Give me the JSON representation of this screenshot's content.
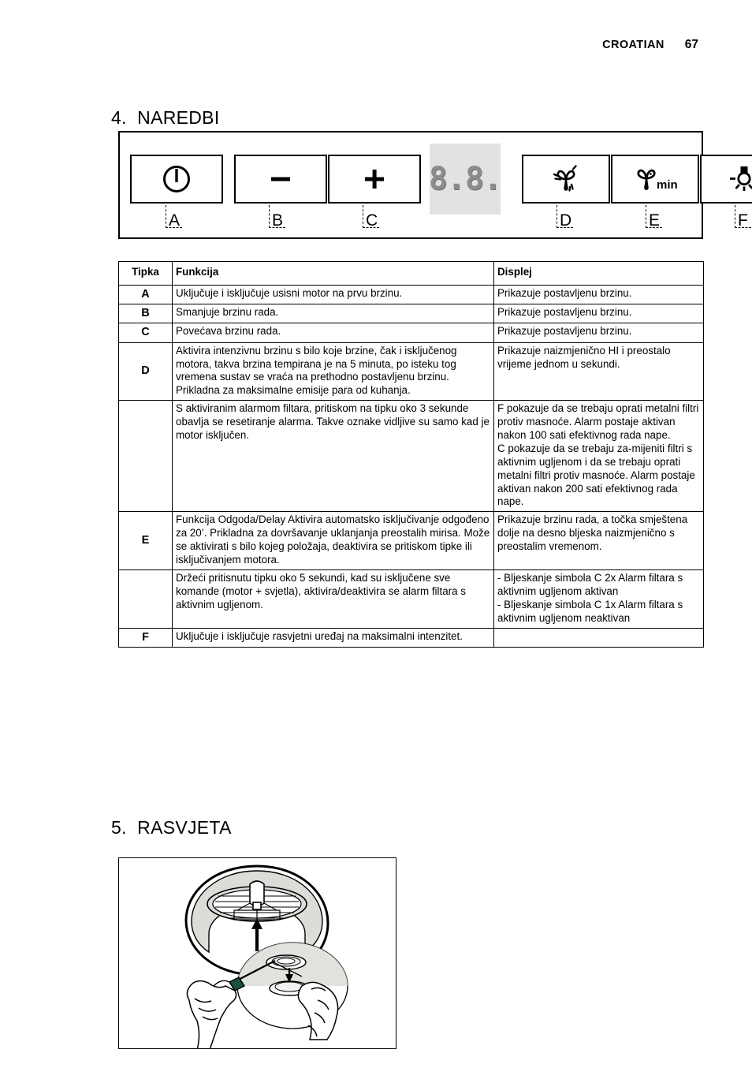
{
  "header": {
    "language": "CROATIAN",
    "page_number": "67"
  },
  "sections": {
    "commands": {
      "heading": "4.  NAREDBI"
    },
    "lighting": {
      "heading": "5.  RASVJETA"
    }
  },
  "control_panel": {
    "keys": [
      {
        "id": "A",
        "label": "A",
        "icon": "power-icon",
        "icon_text": ""
      },
      {
        "id": "B",
        "label": "B",
        "icon": "minus-icon",
        "icon_text": "–"
      },
      {
        "id": "C",
        "label": "C",
        "icon": "plus-icon",
        "icon_text": "+"
      },
      {
        "id": "D",
        "label": "D",
        "icon": "fan-boost-icon",
        "icon_text": ""
      },
      {
        "id": "E",
        "label": "E",
        "icon": "fan-timer-icon",
        "icon_text": "min"
      },
      {
        "id": "F",
        "label": "F",
        "icon": "light-bulb-icon",
        "icon_text": ""
      }
    ],
    "display": {
      "name": "seven-segment-display",
      "value": "8.8.",
      "background_color": "#e2e2e2",
      "segment_color": "#8c8c8c"
    }
  },
  "functions_table": {
    "headers": {
      "key": "Tipka",
      "function": "Funkcija",
      "display": "Displej"
    },
    "rows": [
      {
        "key": "A",
        "function": "Uključuje i isključuje usisni motor na prvu brzinu.",
        "display": "Prikazuje postavljenu brzinu."
      },
      {
        "key": "B",
        "function": "Smanjuje brzinu rada.",
        "display": "Prikazuje postavljenu brzinu."
      },
      {
        "key": "C",
        "function": "Povećava brzinu rada.",
        "display": "Prikazuje postavljenu brzinu."
      },
      {
        "key": "D",
        "function": "Aktivira intenzivnu brzinu s bilo koje brzine, čak i isključenog motora, takva brzina tempirana je na 5 minuta, po isteku tog vremena sustav se vraća na prethodno postavljenu brzinu. Prikladna za maksimalne emisije para od kuhanja.",
        "display": "Prikazuje naizmjenično HI i preostalo vrijeme jednom u sekundi."
      },
      {
        "key": "",
        "function": "S aktiviranim alarmom filtara, pritiskom na tipku oko 3 sekunde obavlja se resetiranje alarma. Takve oznake vidljive su samo kad je motor isključen.",
        "display": "F          pokazuje da se trebaju oprati metalni filtri protiv masnoće. Alarm postaje aktivan nakon 100 sati efektivnog rada nape.\nC          pokazuje da se trebaju za-mijeniti filtri s aktivnim ugljenom i da se trebaju oprati metalni filtri protiv masnoće. Alarm postaje aktivan nakon 200 sati efektivnog rada nape."
      },
      {
        "key": "E",
        "function": " Funkcija Odgoda/Delay Aktivira automatsko isključivanje odgođeno za 20’. Prikladna za dovršavanje uklanjanja preostalih mirisa. Može se aktivirati s bilo kojeg položaja, deaktivira se pritiskom tipke ili isključivanjem motora.",
        "display": "Prikazuje brzinu rada, a točka smještena dolje na desno bljeska naizmjenično s preostalim vremenom."
      },
      {
        "key": "",
        "function": "Držeći pritisnutu tipku oko 5 sekundi, kad su isključene sve komande (motor + svjetla), aktivira/deaktivira se alarm filtara s aktivnim ugljenom.",
        "display": "- Bljeskanje simbola C 2x  Alarm filtara s aktivnim ugljenom aktivan\n- Bljeskanje simbola C 1x Alarm filtara s aktivnim ugljenom neaktivan"
      },
      {
        "key": "F",
        "function": "Uključuje i isključuje rasvjetni uređaj na maksimalni intenzitet.",
        "display": ""
      }
    ]
  },
  "lamp_figure": {
    "name": "lamp-replacement-illustration",
    "description": "Crtez zamjene zarulje"
  }
}
